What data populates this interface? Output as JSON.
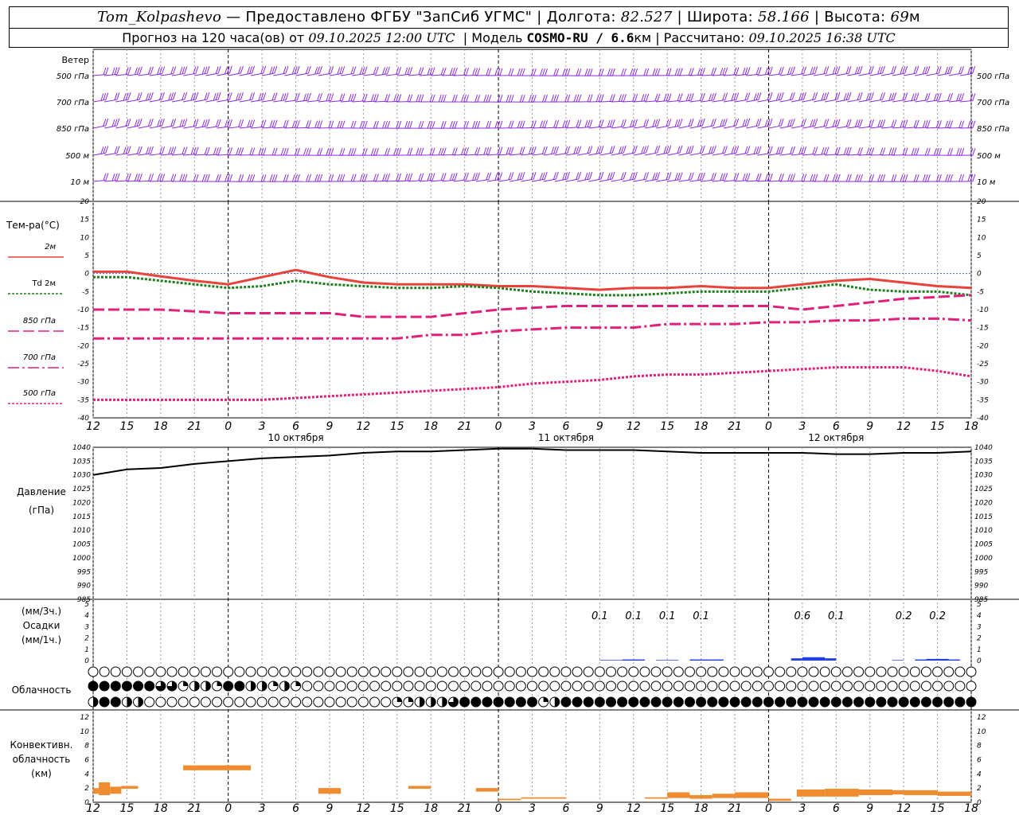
{
  "header": {
    "station": "Tom_Kolpashevo",
    "provided": "— Предоставлено ФГБУ \"ЗапСиб УГМС\"",
    "lon_label": "Долгота:",
    "lon": "82.527",
    "lat_label": "Широта:",
    "lat": "58.166",
    "alt_label": "Высота:",
    "alt": "69",
    "alt_unit": "м",
    "forecast_label": "Прогноз на 120 часа(ов) от",
    "forecast_from": "09.10.2025 12:00 UTC",
    "model_label": "Модель",
    "model": "COSMO-RU / 6.6",
    "model_unit": "км",
    "calc_label": "Рассчитано:",
    "calc": "09.10.2025 16:38 UTC"
  },
  "wind_panel": {
    "title": "Ветер",
    "levels": [
      "500 гПа",
      "700 гПа",
      "850 гПа",
      "500 м",
      "10 м"
    ],
    "color": "#8a2be2"
  },
  "temp_panel": {
    "title": "Тем-ра(°C)",
    "legend": [
      {
        "label": "2м",
        "color": "#e8433a",
        "dash": "solid"
      },
      {
        "label": "Td 2м",
        "color": "#1e7d1e",
        "dash": "dotted"
      },
      {
        "label": "850 гПа",
        "color": "#e0207a",
        "dash": "long"
      },
      {
        "label": "700 гПа",
        "color": "#e0207a",
        "dash": "dashdot"
      },
      {
        "label": "500 гПа",
        "color": "#e0207a",
        "dash": "dotted"
      }
    ]
  },
  "pressure_panel": {
    "title": "Давление",
    "unit": "(гПа)"
  },
  "precip_panel": {
    "unit1": "(мм/3ч.)",
    "title": "Осадки",
    "unit2": "(мм/1ч.)"
  },
  "cloud_panel": {
    "title": "Облачность"
  },
  "conv_panel": {
    "title1": "Конвективн.",
    "title2": "облачность",
    "unit": "(км)"
  },
  "time_axis": {
    "hour_labels": [
      "12",
      "15",
      "18",
      "21",
      "0",
      "3",
      "6",
      "9",
      "12",
      "15",
      "18",
      "21",
      "0",
      "3",
      "6",
      "9",
      "12",
      "15",
      "18",
      "21",
      "0",
      "3",
      "6",
      "9",
      "12",
      "15",
      "18"
    ],
    "date_labels": [
      "10 октября",
      "11 октября",
      "12 октября"
    ]
  },
  "chart_data": [
    {
      "type": "line",
      "name": "temperature",
      "x_hours": [
        0,
        3,
        6,
        9,
        12,
        15,
        18,
        21,
        24,
        27,
        30,
        33,
        36,
        39,
        42,
        45,
        48,
        51,
        54,
        57,
        60,
        63,
        66,
        69,
        72,
        75,
        78
      ],
      "ylim": [
        -40,
        20
      ],
      "yticks": [
        20,
        15,
        10,
        5,
        0,
        -5,
        -10,
        -15,
        -20,
        -25,
        -30,
        -35,
        -40
      ],
      "series": [
        {
          "name": "2м",
          "values": [
            0.5,
            0.5,
            -0.8,
            -2,
            -3,
            -1,
            1,
            -1,
            -2.5,
            -3,
            -3,
            -3,
            -3.5,
            -3.5,
            -4,
            -4.5,
            -4,
            -4,
            -3.5,
            -4,
            -4,
            -3,
            -2,
            -1.5,
            -2.5,
            -3.5,
            -4
          ]
        },
        {
          "name": "Td 2м",
          "values": [
            -1,
            -1,
            -2,
            -3,
            -4,
            -3.5,
            -2,
            -3,
            -3.5,
            -4,
            -4,
            -3.5,
            -4,
            -5,
            -5.5,
            -6,
            -6,
            -5.5,
            -5,
            -5,
            -5,
            -4,
            -3,
            -4.5,
            -5,
            -5,
            -6
          ]
        },
        {
          "name": "850 гПа",
          "values": [
            -10,
            -10,
            -10,
            -10.5,
            -11,
            -11,
            -11,
            -11,
            -12,
            -12,
            -12,
            -11,
            -10,
            -9.5,
            -9,
            -9,
            -9,
            -9,
            -9,
            -9,
            -9,
            -10,
            -9,
            -8,
            -7,
            -6.5,
            -6
          ]
        },
        {
          "name": "700 гПа",
          "values": [
            -18,
            -18,
            -18,
            -18,
            -18,
            -18,
            -18,
            -18,
            -18,
            -18,
            -17,
            -17,
            -16,
            -15.5,
            -15,
            -15,
            -15,
            -14,
            -14,
            -14,
            -13.5,
            -13.5,
            -13,
            -13,
            -12.5,
            -12.5,
            -13
          ]
        },
        {
          "name": "500 гПа",
          "values": [
            -35,
            -35,
            -35,
            -35,
            -35,
            -35,
            -34.5,
            -34,
            -33.5,
            -33,
            -32.5,
            -32,
            -31.5,
            -30.5,
            -30,
            -29.5,
            -28.5,
            -28,
            -28,
            -27.5,
            -27,
            -26.5,
            -26,
            -26,
            -26,
            -27,
            -28.5
          ]
        }
      ]
    },
    {
      "type": "line",
      "name": "pressure",
      "x_hours": [
        0,
        3,
        6,
        9,
        12,
        15,
        18,
        21,
        24,
        27,
        30,
        33,
        36,
        39,
        42,
        45,
        48,
        51,
        54,
        57,
        60,
        63,
        66,
        69,
        72,
        75,
        78
      ],
      "ylim": [
        985,
        1040
      ],
      "yticks": [
        1040,
        1035,
        1030,
        1025,
        1020,
        1015,
        1010,
        1005,
        1000,
        995,
        990,
        985
      ],
      "series": [
        {
          "name": "Давление",
          "values": [
            1030,
            1032,
            1032.5,
            1034,
            1035,
            1036,
            1036.5,
            1037,
            1038,
            1038.5,
            1038.5,
            1039,
            1039.5,
            1039.5,
            1039,
            1039,
            1039,
            1038.5,
            1038,
            1038,
            1038,
            1038,
            1037.5,
            1037.5,
            1038,
            1038,
            1038.5
          ]
        }
      ]
    },
    {
      "type": "bar",
      "name": "precipitation",
      "ylim": [
        0,
        5
      ],
      "yticks": [
        5,
        4,
        3,
        2,
        1,
        0
      ],
      "labels_3h": [
        {
          "hour": 45,
          "text": "0.1"
        },
        {
          "hour": 48,
          "text": "0.1"
        },
        {
          "hour": 51,
          "text": "0.1"
        },
        {
          "hour": 54,
          "text": "0.1"
        },
        {
          "hour": 63,
          "text": "0.6"
        },
        {
          "hour": 66,
          "text": "0.1"
        },
        {
          "hour": 72,
          "text": "0.2"
        },
        {
          "hour": 75,
          "text": "0.2"
        }
      ],
      "hourly_bars": [
        {
          "hour": 45,
          "mm": 0.05
        },
        {
          "hour": 46,
          "mm": 0.05
        },
        {
          "hour": 47,
          "mm": 0.1
        },
        {
          "hour": 48,
          "mm": 0.1
        },
        {
          "hour": 50,
          "mm": 0.05
        },
        {
          "hour": 51,
          "mm": 0.05
        },
        {
          "hour": 53,
          "mm": 0.1
        },
        {
          "hour": 54,
          "mm": 0.1
        },
        {
          "hour": 55,
          "mm": 0.1
        },
        {
          "hour": 62,
          "mm": 0.2
        },
        {
          "hour": 63,
          "mm": 0.3
        },
        {
          "hour": 64,
          "mm": 0.3
        },
        {
          "hour": 65,
          "mm": 0.2
        },
        {
          "hour": 71,
          "mm": 0.05
        },
        {
          "hour": 73,
          "mm": 0.1
        },
        {
          "hour": 74,
          "mm": 0.15
        },
        {
          "hour": 75,
          "mm": 0.15
        },
        {
          "hour": 76,
          "mm": 0.1
        }
      ],
      "color": "#1f3fe0"
    },
    {
      "type": "table",
      "name": "cloudiness",
      "note": "cover fraction per hour (0..1), rows: upper, middle, lower",
      "upper": [
        0,
        0,
        0,
        0,
        0,
        0,
        0,
        0,
        0,
        0,
        0,
        0,
        0,
        0,
        0,
        0,
        0,
        0,
        0,
        0,
        0,
        0,
        0,
        0,
        0,
        0,
        0,
        0,
        0,
        0,
        0,
        0,
        0,
        0,
        0,
        0,
        0,
        0,
        0,
        0,
        0,
        0,
        0,
        0,
        0,
        0,
        0,
        0,
        0,
        0,
        0,
        0,
        0,
        0,
        0,
        0,
        0,
        0,
        0,
        0,
        0,
        0,
        0,
        0,
        0,
        0,
        0,
        0,
        0,
        0,
        0,
        0,
        0,
        0,
        0,
        0,
        0,
        0,
        0
      ],
      "middle": [
        1,
        1,
        1,
        1,
        1,
        1,
        0.75,
        0.75,
        0.25,
        0.5,
        0.5,
        0.25,
        1,
        1,
        0.5,
        0.5,
        0.25,
        0.5,
        0.25,
        0,
        0,
        0,
        0,
        0,
        0,
        0,
        0,
        0,
        0,
        0,
        0,
        0,
        0,
        0,
        0,
        0,
        0,
        0,
        0,
        0,
        0,
        0,
        0,
        0,
        0,
        0,
        0,
        0,
        0,
        0,
        0,
        0,
        0,
        0,
        0,
        0,
        0,
        0,
        0,
        0,
        0,
        0,
        0,
        0,
        0,
        0,
        0,
        0,
        0,
        0,
        0,
        0,
        0,
        0,
        0,
        0,
        0,
        0,
        0
      ],
      "lower": [
        0.5,
        1,
        1,
        0.5,
        0.5,
        0,
        0,
        0,
        0,
        0,
        0,
        0,
        0,
        0,
        0,
        0,
        0,
        0,
        0,
        0,
        0,
        0,
        0,
        0,
        0,
        0,
        0,
        0.25,
        0.25,
        0.5,
        0.5,
        0.5,
        0.75,
        1,
        1,
        1,
        1,
        1,
        1,
        1,
        0.25,
        0.5,
        1,
        1,
        1,
        1,
        1,
        1,
        1,
        1,
        1,
        1,
        1,
        1,
        1,
        1,
        1,
        1,
        1,
        1,
        1,
        1,
        1,
        1,
        1,
        1,
        1,
        1,
        1,
        1,
        1,
        1,
        1,
        1,
        1,
        1,
        1,
        1,
        1
      ]
    },
    {
      "type": "bar",
      "name": "convective_cloud",
      "ylim": [
        0,
        13
      ],
      "yticks": [
        12,
        10,
        8,
        6,
        4,
        2,
        0
      ],
      "color": "#f08c30",
      "segments": [
        {
          "h0": 0,
          "h1": 0.5,
          "bottom": 1.2,
          "top": 2.0
        },
        {
          "h0": 0.5,
          "h1": 1.5,
          "bottom": 1.0,
          "top": 2.8
        },
        {
          "h0": 1.5,
          "h1": 2.5,
          "bottom": 1.2,
          "top": 2.2
        },
        {
          "h0": 2.5,
          "h1": 4.0,
          "bottom": 1.9,
          "top": 2.3
        },
        {
          "h0": 8,
          "h1": 14,
          "bottom": 4.5,
          "top": 5.2
        },
        {
          "h0": 20,
          "h1": 22,
          "bottom": 1.2,
          "top": 2.0
        },
        {
          "h0": 28,
          "h1": 30,
          "bottom": 1.9,
          "top": 2.3
        },
        {
          "h0": 34,
          "h1": 36,
          "bottom": 1.5,
          "top": 2.0
        },
        {
          "h0": 36,
          "h1": 38,
          "bottom": 0.3,
          "top": 0.5
        },
        {
          "h0": 38,
          "h1": 42,
          "bottom": 0.5,
          "top": 0.7
        },
        {
          "h0": 49,
          "h1": 51,
          "bottom": 0.5,
          "top": 0.7
        },
        {
          "h0": 51,
          "h1": 53,
          "bottom": 0.6,
          "top": 1.4
        },
        {
          "h0": 53,
          "h1": 55,
          "bottom": 0.5,
          "top": 1.0
        },
        {
          "h0": 55,
          "h1": 57,
          "bottom": 0.6,
          "top": 1.2
        },
        {
          "h0": 57,
          "h1": 60,
          "bottom": 0.6,
          "top": 1.4
        },
        {
          "h0": 60,
          "h1": 62,
          "bottom": 0.2,
          "top": 0.5
        },
        {
          "h0": 62.5,
          "h1": 65,
          "bottom": 0.8,
          "top": 1.8
        },
        {
          "h0": 65,
          "h1": 68,
          "bottom": 0.8,
          "top": 1.9
        },
        {
          "h0": 68,
          "h1": 71,
          "bottom": 1.0,
          "top": 1.8
        },
        {
          "h0": 71,
          "h1": 72,
          "bottom": 1.1,
          "top": 1.7
        },
        {
          "h0": 72,
          "h1": 75,
          "bottom": 1.0,
          "top": 1.7
        },
        {
          "h0": 75,
          "h1": 78,
          "bottom": 0.9,
          "top": 1.5
        }
      ]
    }
  ]
}
